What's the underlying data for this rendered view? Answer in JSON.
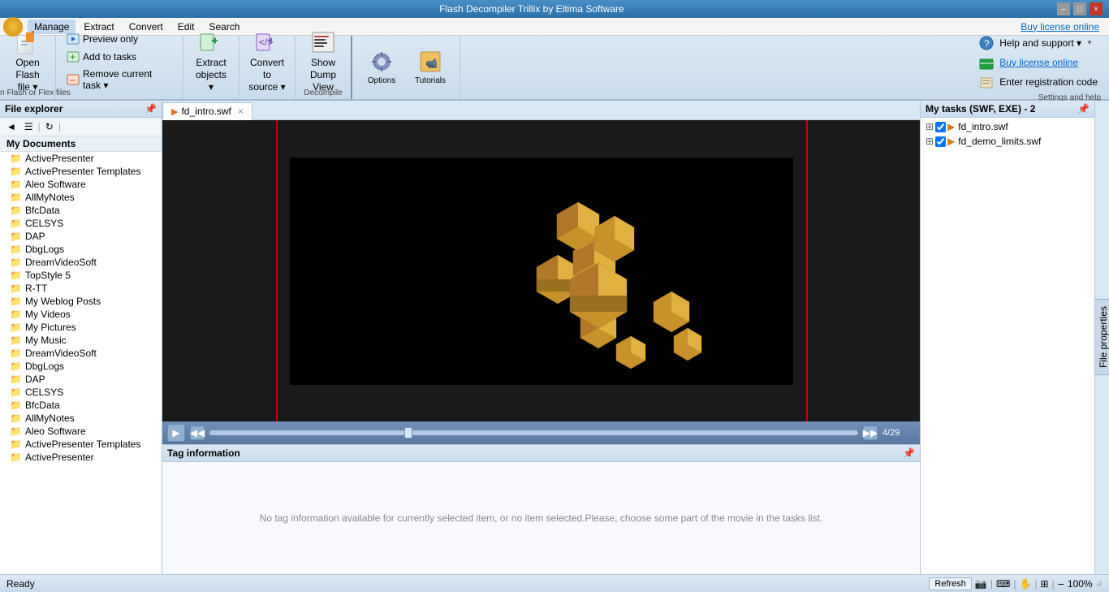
{
  "window": {
    "title": "Flash Decompiler Trillix by Eltima Software",
    "controls": [
      "–",
      "□",
      "×"
    ]
  },
  "menubar": {
    "logo_alt": "app-logo",
    "items": [
      "Manage",
      "Extract",
      "Convert",
      "Edit",
      "Search"
    ],
    "active": "Manage",
    "buy_link": "Buy license online"
  },
  "toolbar": {
    "open_flash": {
      "label_line1": "Open",
      "label_line2": "Flash file ▾"
    },
    "open_flex": {
      "label": "Open Flash or Flex files"
    },
    "preview": {
      "label": "Preview only"
    },
    "add_tasks": {
      "label": "Add to tasks"
    },
    "remove_task": {
      "label": "Remove current task ▾"
    },
    "extract": {
      "label_line1": "Extract",
      "label_line2": "objects ▾"
    },
    "convert": {
      "label_line1": "Convert to",
      "label_line2": "source ▾"
    },
    "dump": {
      "label_line1": "Show",
      "label_line2": "Dump View"
    },
    "decompile_label": "Decompile",
    "options": {
      "label": "Options"
    },
    "tutorials": {
      "label": "Tutorials"
    },
    "help": {
      "label": "Help and support ▾"
    },
    "buy": {
      "label": "Buy license online"
    },
    "register": {
      "label": "Enter registration code"
    },
    "settings_label": "Settings and help"
  },
  "file_explorer": {
    "title": "File explorer",
    "root": "My Documents",
    "items": [
      "ActivePresenter",
      "ActivePresenter Templates",
      "Aleo Software",
      "AllMyNotes",
      "BfcData",
      "CELSYS",
      "DAP",
      "DbgLogs",
      "DreamVideoSoft",
      "TopStyle 5",
      "R-TT",
      "My Weblog Posts",
      "My Videos",
      "My Pictures",
      "My Music",
      "DreamVideoSoft",
      "DbgLogs",
      "DAP",
      "CELSYS",
      "BfcData",
      "AllMyNotes",
      "Aleo Software",
      "ActivePresenter Templates",
      "ActivePresenter"
    ]
  },
  "preview": {
    "tab_label": "fd_intro.swf",
    "tab_icon": "swf-icon"
  },
  "playback": {
    "frame_current": 4,
    "frame_total": 29,
    "frame_display": "4/29"
  },
  "tag_info": {
    "title": "Tag information",
    "empty_message": "No tag information available for currently selected item, or no item selected.Please, choose some part of the movie in the tasks list."
  },
  "tasks_panel": {
    "title": "My tasks (SWF, EXE) - 2",
    "items": [
      {
        "name": "fd_intro.swf",
        "expanded": true
      },
      {
        "name": "fd_demo_limits.swf",
        "expanded": true
      }
    ]
  },
  "file_properties_tab": "File properties",
  "statusbar": {
    "status": "Ready",
    "refresh_btn": "Refresh",
    "zoom": "100%",
    "separator": "|"
  }
}
